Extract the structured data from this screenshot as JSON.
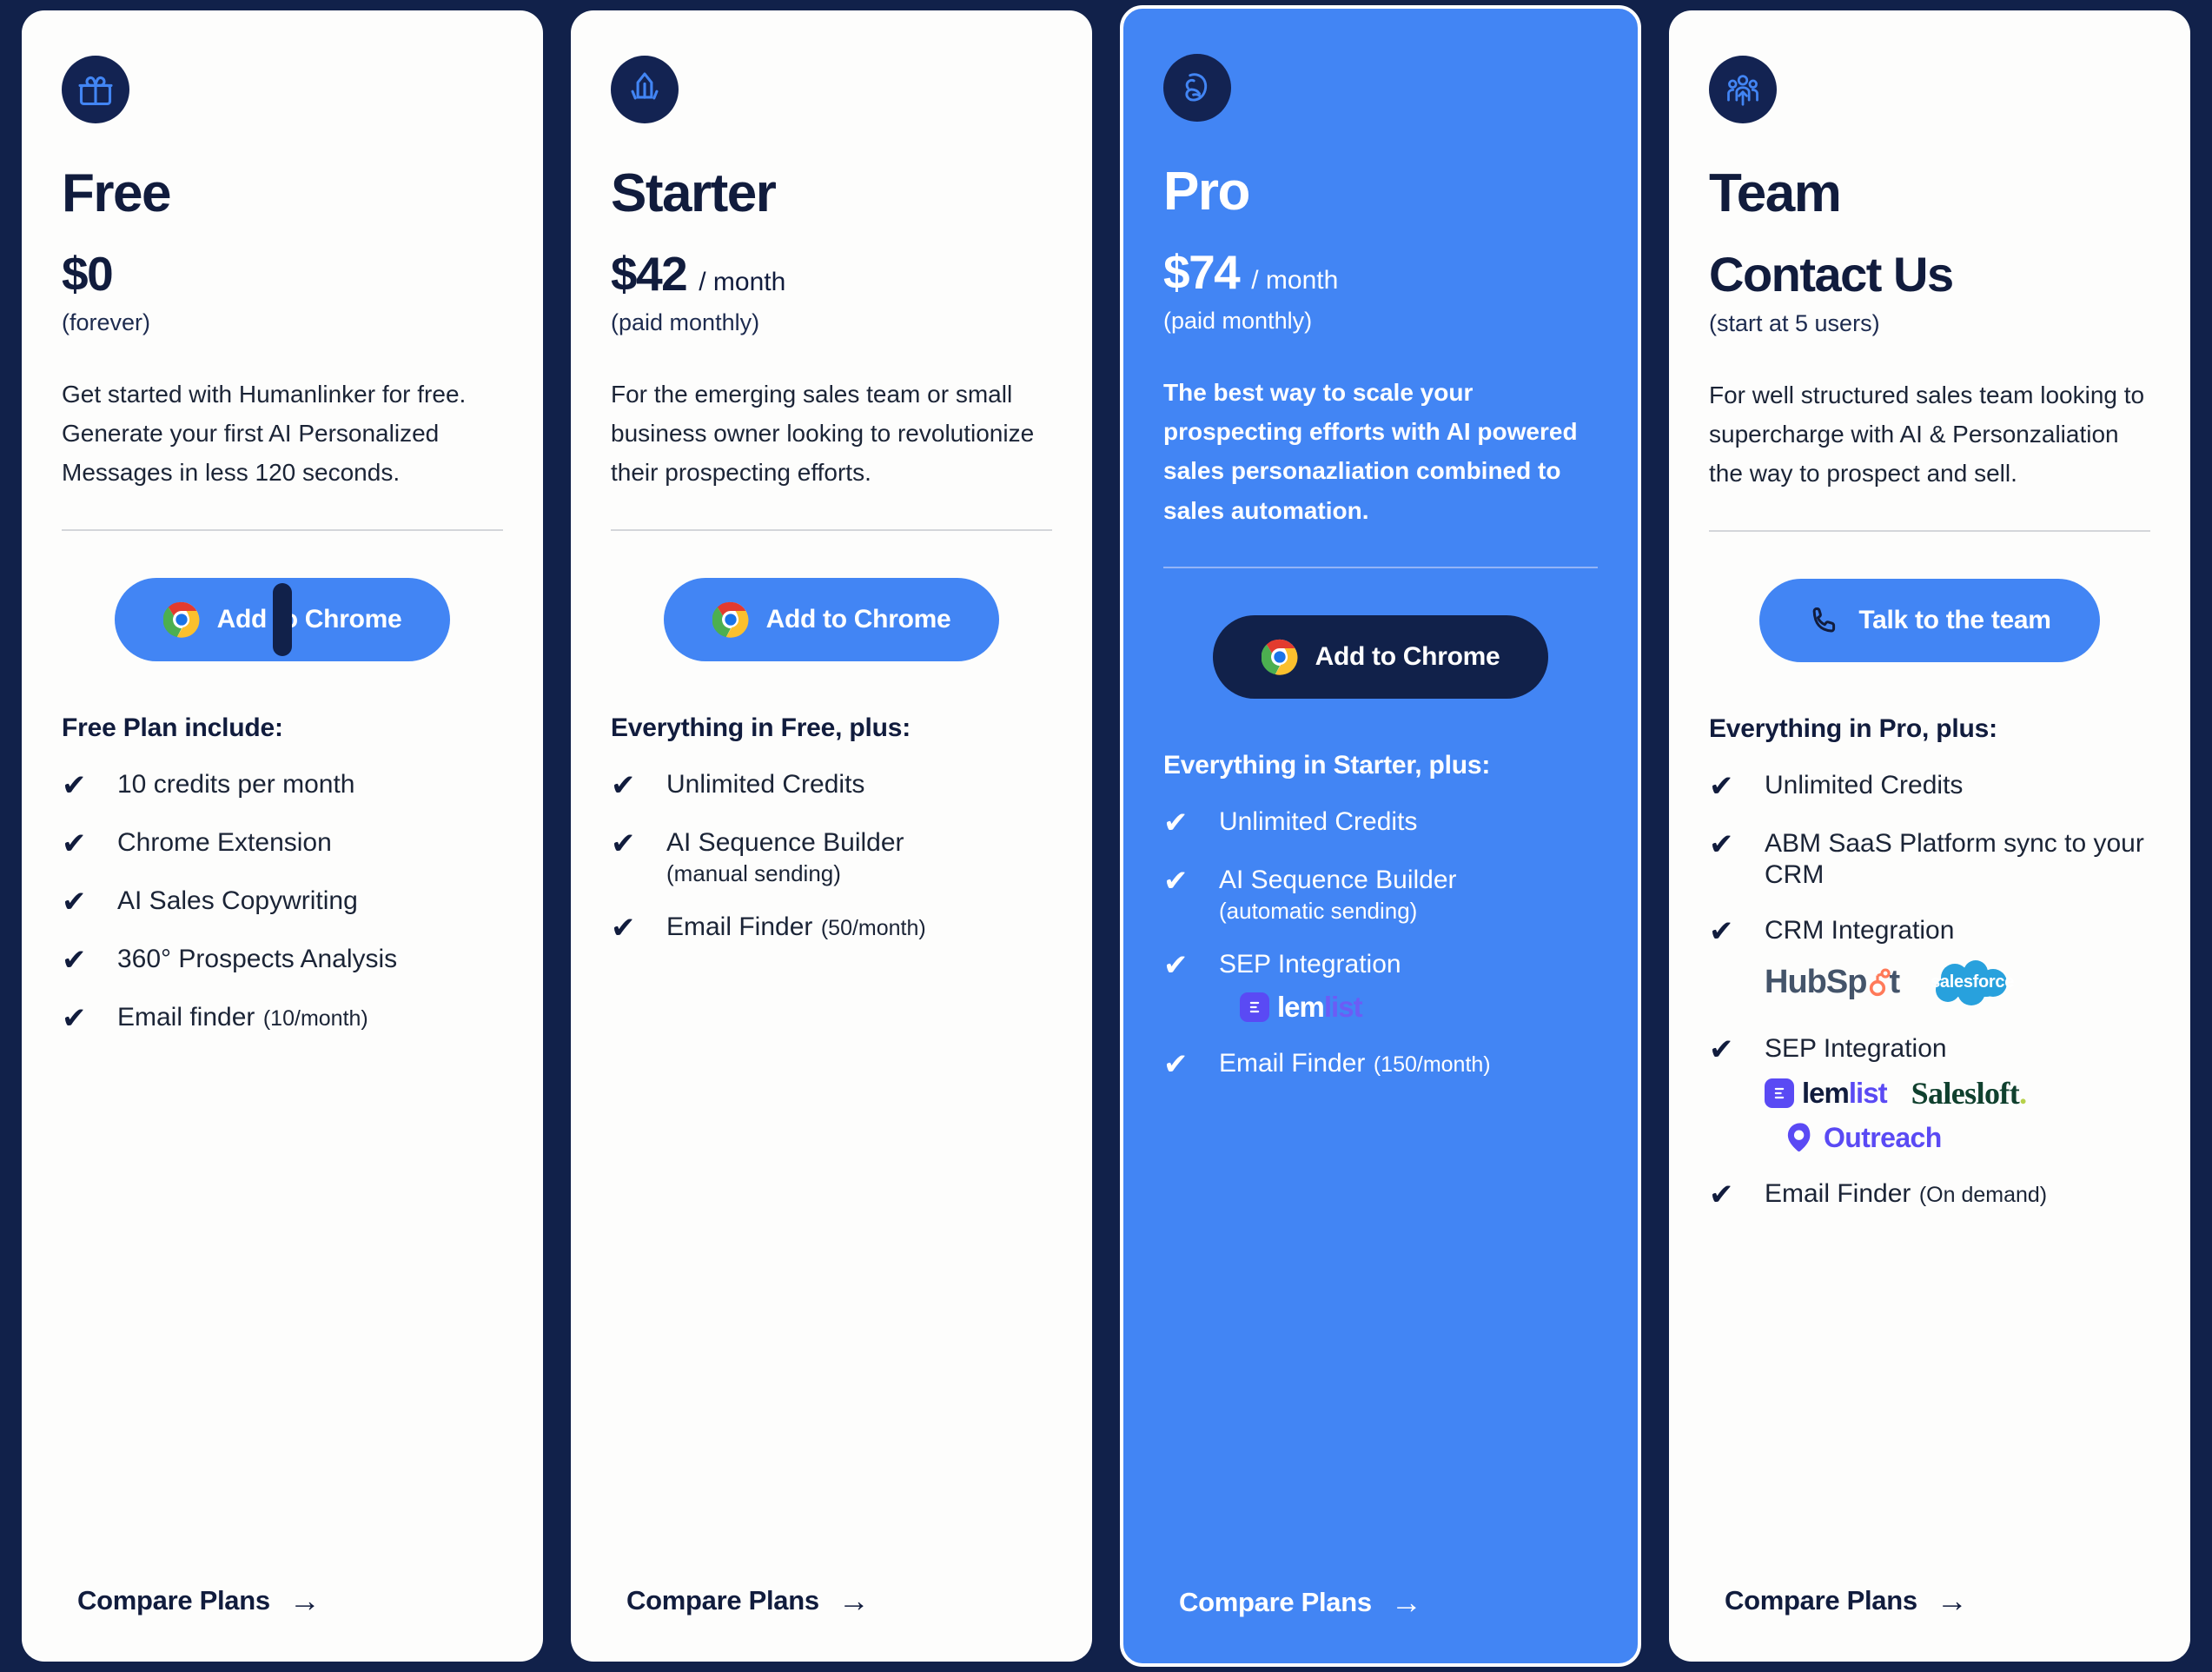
{
  "theme": {
    "page_background": "#11214a",
    "accent_blue": "#4285f4",
    "dark_navy": "#111c3d",
    "card_background": "#fdfdfc"
  },
  "plans": [
    {
      "id": "free",
      "icon": "gift-icon",
      "name": "Free",
      "price": "$0",
      "period": "",
      "note": "(forever)",
      "description": "Get started with Humanlinker for free. Generate your first AI Personalized Messages in less 120 seconds.",
      "cta": {
        "label": "Add to Chrome",
        "icon": "chrome-icon",
        "style": "blue",
        "caret": true
      },
      "features_title": "Free Plan include:",
      "features": [
        {
          "text": "10 credits per month"
        },
        {
          "text": "Chrome Extension"
        },
        {
          "text": "AI Sales Copywriting"
        },
        {
          "text": "360° Prospects Analysis"
        },
        {
          "text": "Email finder",
          "suffix": "(10/month)"
        }
      ],
      "footer_link": "Compare Plans"
    },
    {
      "id": "starter",
      "icon": "rocket-icon",
      "name": "Starter",
      "price": "$42",
      "period": "/ month",
      "note": "(paid monthly)",
      "description": "For the emerging sales team or small business owner looking to revolutionize their prospecting efforts.",
      "cta": {
        "label": "Add to Chrome",
        "icon": "chrome-icon",
        "style": "blue",
        "caret": false
      },
      "features_title": "Everything in Free, plus:",
      "features": [
        {
          "text": "Unlimited Credits"
        },
        {
          "text": "AI Sequence Builder",
          "subline": "(manual sending)"
        },
        {
          "text": "Email Finder",
          "suffix": "(50/month)"
        }
      ],
      "footer_link": "Compare Plans"
    },
    {
      "id": "pro",
      "icon": "muscle-icon",
      "name": "Pro",
      "price": "$74",
      "period": "/ month",
      "note": "(paid monthly)",
      "description": "The best way to scale your prospecting efforts with AI powered sales personazliation combined to sales automation.",
      "cta": {
        "label": "Add to Chrome",
        "icon": "chrome-icon",
        "style": "dark",
        "caret": false
      },
      "features_title": "Everything in Starter, plus:",
      "features": [
        {
          "text": "Unlimited Credits"
        },
        {
          "text": "AI Sequence Builder",
          "subline": "(automatic sending)"
        },
        {
          "text": "SEP Integration",
          "logos": [
            "lemlist"
          ]
        },
        {
          "text": "Email Finder",
          "suffix": "(150/month)"
        }
      ],
      "footer_link": "Compare Plans",
      "highlighted": true
    },
    {
      "id": "team",
      "icon": "team-icon",
      "name": "Team",
      "price": "Contact Us",
      "period": "",
      "note": "(start at 5 users)",
      "description": "For well structured sales team looking to supercharge with AI & Personzaliation the way to prospect and sell.",
      "cta": {
        "label": "Talk to the team",
        "icon": "phone-icon",
        "style": "blue",
        "caret": false
      },
      "features_title": "Everything in Pro, plus:",
      "features": [
        {
          "text": "Unlimited Credits"
        },
        {
          "text": "ABM SaaS Platform sync to your CRM"
        },
        {
          "text": "CRM Integration",
          "logos": [
            "hubspot",
            "salesforce"
          ]
        },
        {
          "text": "SEP Integration",
          "logos": [
            "lemlist",
            "salesloft",
            "outreach"
          ]
        },
        {
          "text": "Email Finder",
          "suffix": "(On demand)"
        }
      ],
      "footer_link": "Compare Plans"
    }
  ],
  "brands": {
    "lemlist": {
      "part_a": "lem",
      "part_b": "list"
    },
    "salesloft": {
      "name": "Salesloft",
      "dot": "."
    },
    "outreach": {
      "name": "Outreach"
    },
    "hubspot": {
      "part_a": "HubSp",
      "part_b": "t"
    },
    "salesforce": {
      "name": "salesforce"
    }
  },
  "icons": {
    "check": "✔",
    "arrow_right": "→"
  }
}
